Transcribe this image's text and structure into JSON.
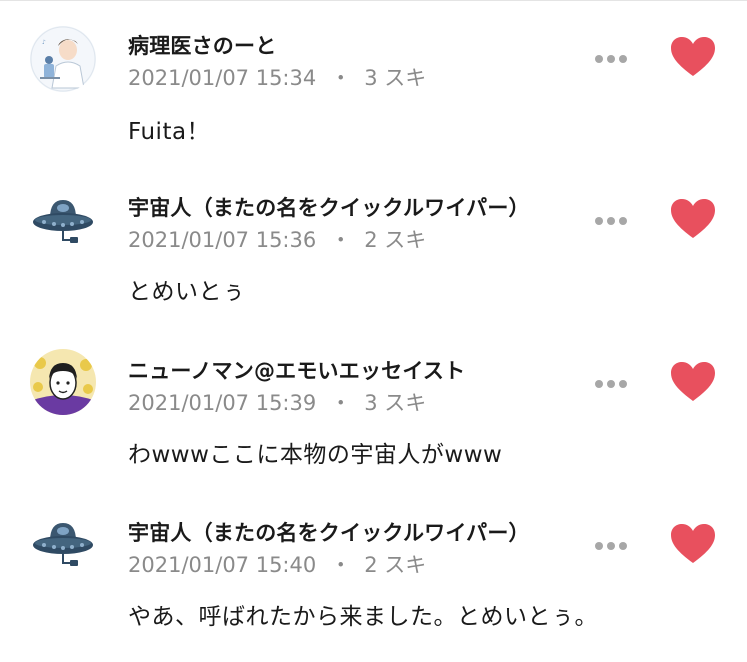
{
  "comments": [
    {
      "author": "病理医さのーと",
      "timestamp": "2021/01/07 15:34",
      "separator": "・",
      "likes": "3 スキ",
      "text": "Fuita！",
      "avatar_icon": "doctor-illustration-icon",
      "liked": true
    },
    {
      "author": "宇宙人（またの名をクイックルワイパー）",
      "timestamp": "2021/01/07 15:36",
      "separator": "・",
      "likes": "2 スキ",
      "text": "とめいとぅ",
      "avatar_icon": "ufo-icon",
      "liked": true
    },
    {
      "author": "ニューノマン@エモいエッセイスト",
      "timestamp": "2021/01/07 15:39",
      "separator": "・",
      "likes": "3 スキ",
      "text": "わwwwここに本物の宇宙人がwww",
      "avatar_icon": "person-portrait-icon",
      "liked": true
    },
    {
      "author": "宇宙人（またの名をクイックルワイパー）",
      "timestamp": "2021/01/07 15:40",
      "separator": "・",
      "likes": "2 スキ",
      "text": "やあ、呼ばれたから来ました。とめいとぅ。",
      "avatar_icon": "ufo-icon",
      "liked": true
    }
  ],
  "colors": {
    "heart": "#e8505e",
    "meta_text": "#8a8a8a",
    "more_dots": "#a7a7a7"
  }
}
